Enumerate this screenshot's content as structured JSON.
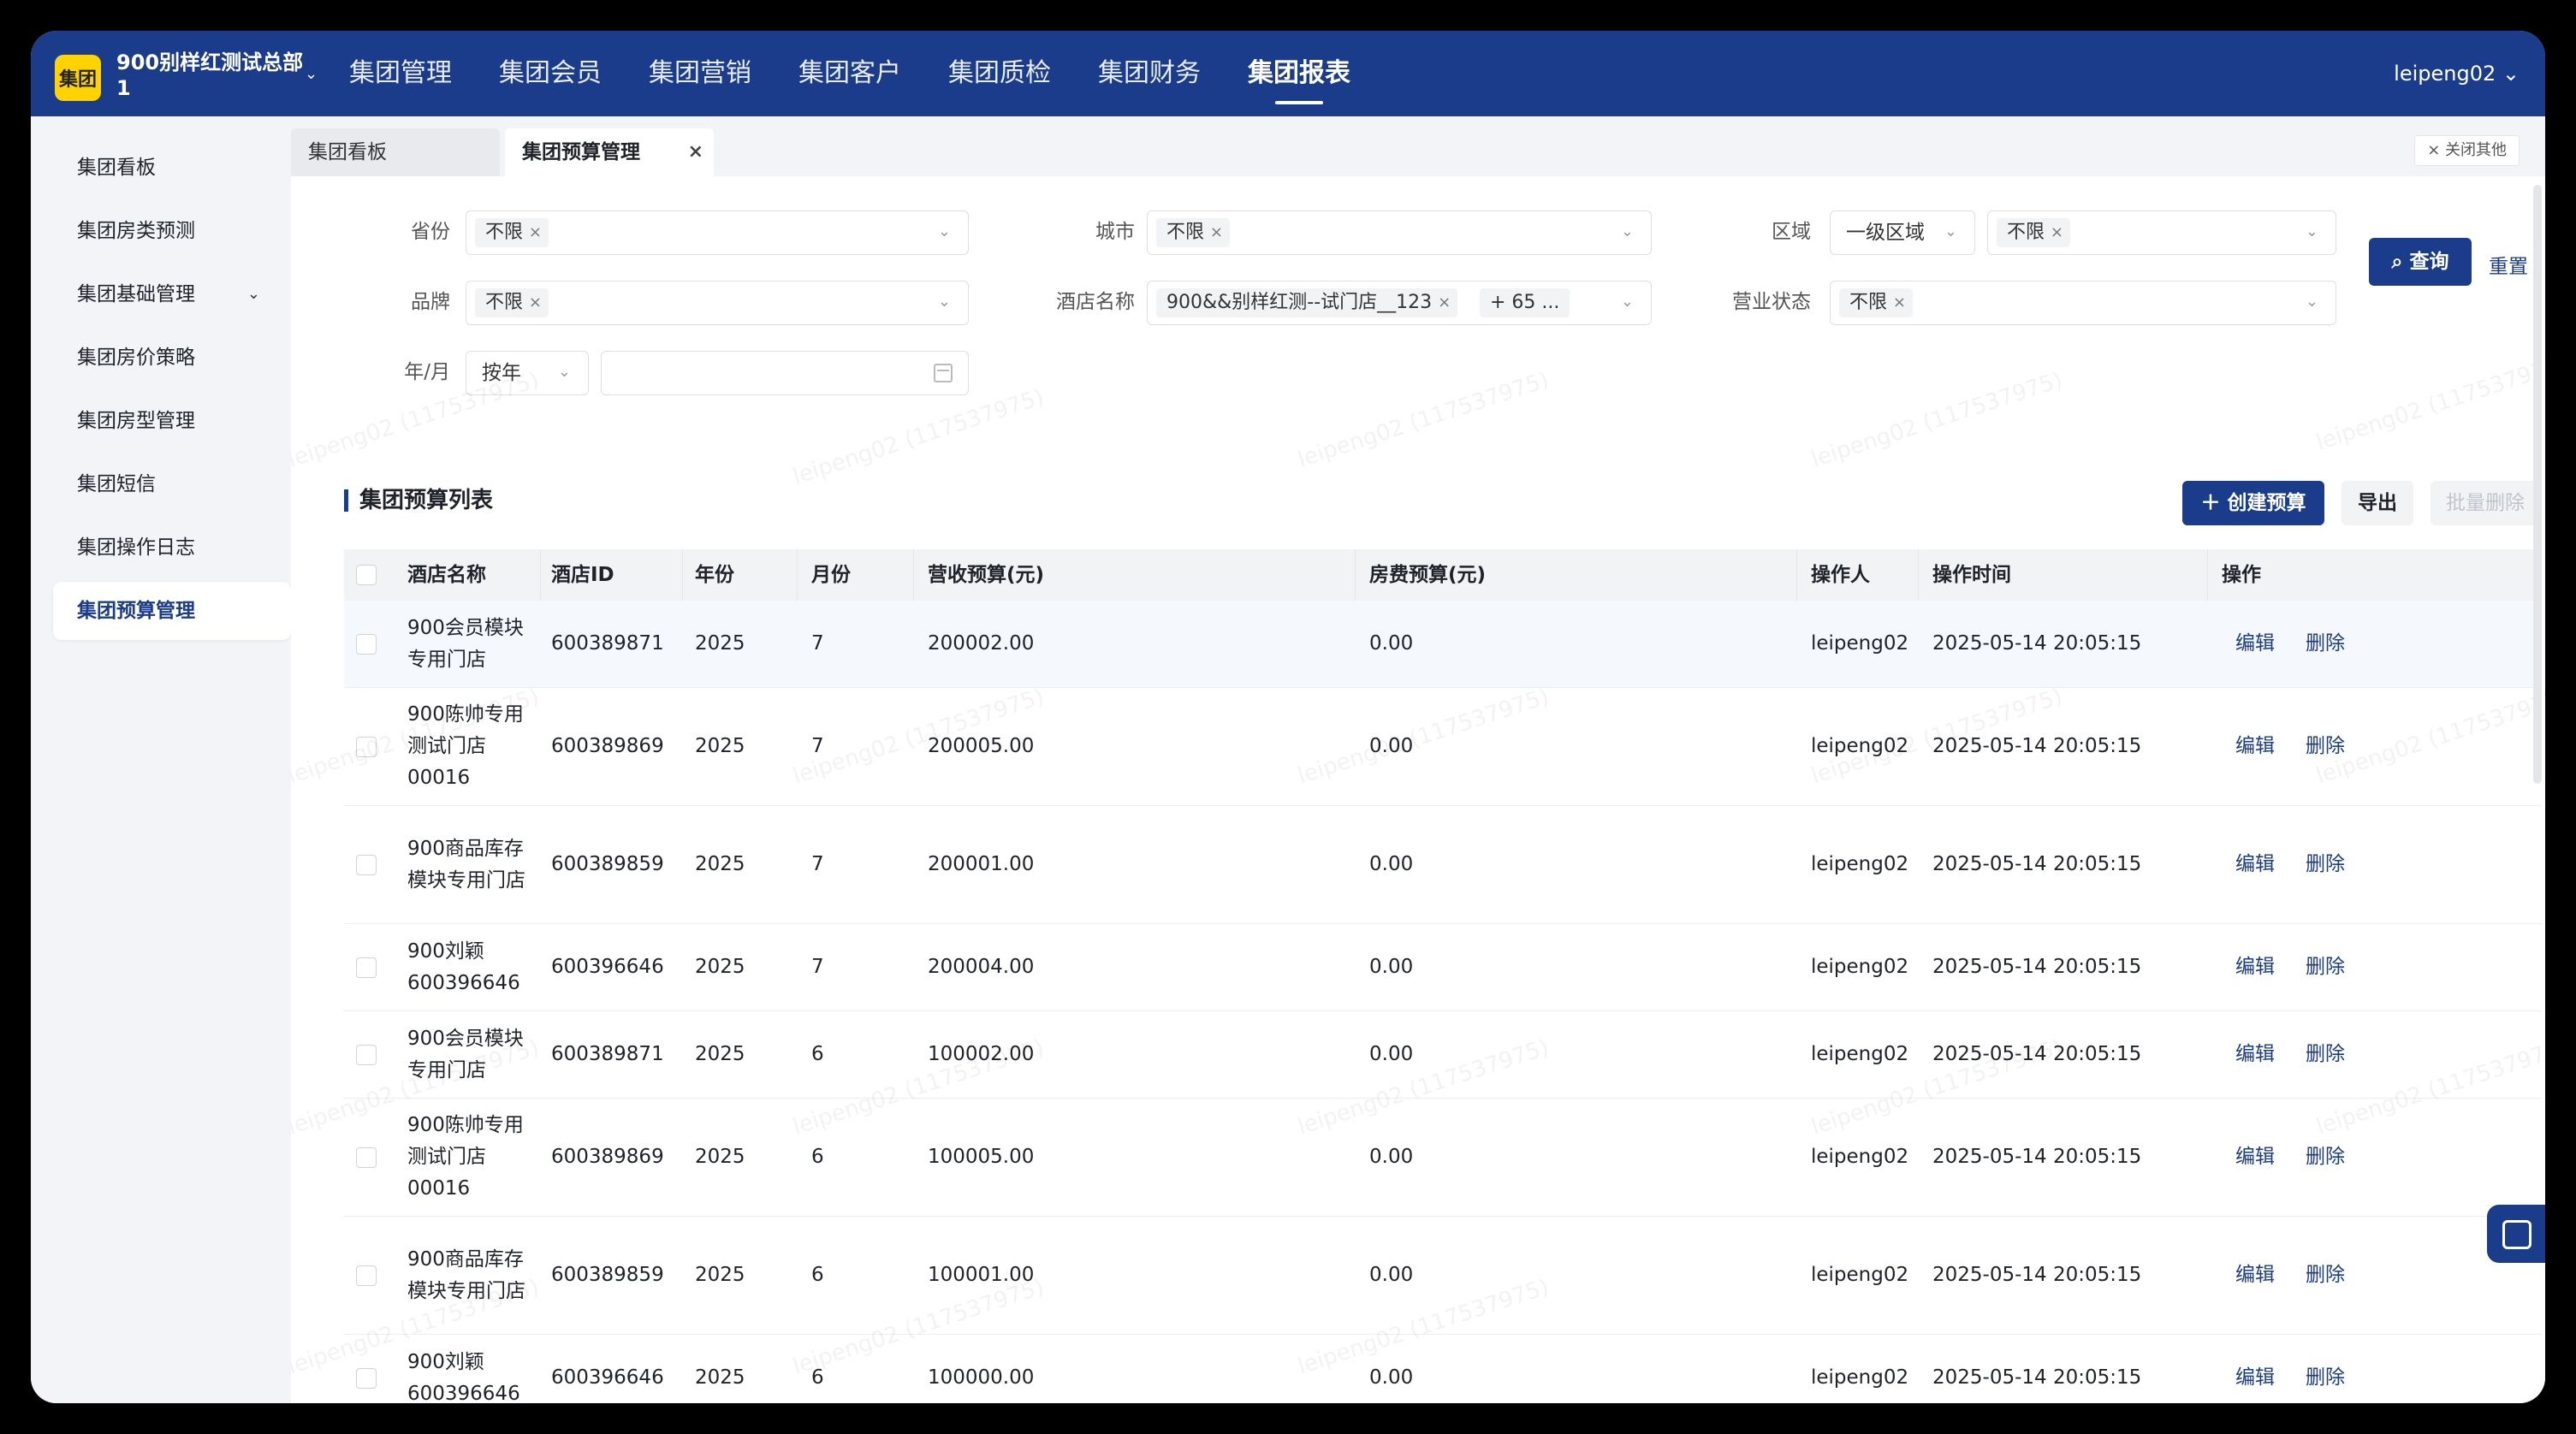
{
  "header": {
    "logo_text": "集团",
    "org_name": "900别样红测试总部1",
    "nav": [
      "集团管理",
      "集团会员",
      "集团营销",
      "集团客户",
      "集团质检",
      "集团财务",
      "集团报表"
    ],
    "active_nav": 6,
    "user": "leipeng02"
  },
  "sidebar": {
    "items": [
      {
        "label": "集团看板"
      },
      {
        "label": "集团房类预测"
      },
      {
        "label": "集团基础管理"
      },
      {
        "label": "集团房价策略"
      },
      {
        "label": "集团房型管理"
      },
      {
        "label": "集团短信"
      },
      {
        "label": "集团操作日志"
      },
      {
        "label": "集团预算管理"
      }
    ]
  },
  "tabs": {
    "items": [
      {
        "label": "集团看板"
      },
      {
        "label": "集团预算管理"
      }
    ],
    "close_others": "× 关闭其他"
  },
  "filters": {
    "province": {
      "label": "省份",
      "tag": "不限"
    },
    "city": {
      "label": "城市",
      "tag": "不限"
    },
    "region": {
      "label": "区域",
      "level": "一级区域",
      "tag": "不限"
    },
    "brand": {
      "label": "品牌",
      "tag": "不限"
    },
    "hotel": {
      "label": "酒店名称",
      "tag": "900&&别样红测--试门店__123",
      "more": "+ 65 ..."
    },
    "status": {
      "label": "营业状态",
      "tag": "不限"
    },
    "period": {
      "label": "年/月",
      "mode": "按年"
    },
    "query": "查询",
    "reset": "重置"
  },
  "list": {
    "title": "集团预算列表",
    "create": "创建预算",
    "export": "导出",
    "batch_delete": "批量删除",
    "columns": [
      "酒店名称",
      "酒店ID",
      "年份",
      "月份",
      "营收预算(元)",
      "房费预算(元)",
      "操作人",
      "操作时间",
      "操作"
    ],
    "edit": "编辑",
    "delete": "删除",
    "rows": [
      {
        "name": "900会员模块专用门店",
        "id": "600389871",
        "year": "2025",
        "month": "7",
        "revenue": "200002.00",
        "room": "0.00",
        "operator": "leipeng02",
        "time": "2025-05-14 20:05:15"
      },
      {
        "name": "900陈帅专用测试门店00016",
        "id": "600389869",
        "year": "2025",
        "month": "7",
        "revenue": "200005.00",
        "room": "0.00",
        "operator": "leipeng02",
        "time": "2025-05-14 20:05:15"
      },
      {
        "name": "900商品库存模块专用门店",
        "id": "600389859",
        "year": "2025",
        "month": "7",
        "revenue": "200001.00",
        "room": "0.00",
        "operator": "leipeng02",
        "time": "2025-05-14 20:05:15"
      },
      {
        "name": "900刘颖600396646",
        "id": "600396646",
        "year": "2025",
        "month": "7",
        "revenue": "200004.00",
        "room": "0.00",
        "operator": "leipeng02",
        "time": "2025-05-14 20:05:15"
      },
      {
        "name": "900会员模块专用门店",
        "id": "600389871",
        "year": "2025",
        "month": "6",
        "revenue": "100002.00",
        "room": "0.00",
        "operator": "leipeng02",
        "time": "2025-05-14 20:05:15"
      },
      {
        "name": "900陈帅专用测试门店00016",
        "id": "600389869",
        "year": "2025",
        "month": "6",
        "revenue": "100005.00",
        "room": "0.00",
        "operator": "leipeng02",
        "time": "2025-05-14 20:05:15"
      },
      {
        "name": "900商品库存模块专用门店",
        "id": "600389859",
        "year": "2025",
        "month": "6",
        "revenue": "100001.00",
        "room": "0.00",
        "operator": "leipeng02",
        "time": "2025-05-14 20:05:15"
      },
      {
        "name": "900刘颖600396646",
        "id": "600396646",
        "year": "2025",
        "month": "6",
        "revenue": "100000.00",
        "room": "0.00",
        "operator": "leipeng02",
        "time": "2025-05-14 20:05:15"
      }
    ]
  },
  "watermark": "leipeng02 (117537975)"
}
